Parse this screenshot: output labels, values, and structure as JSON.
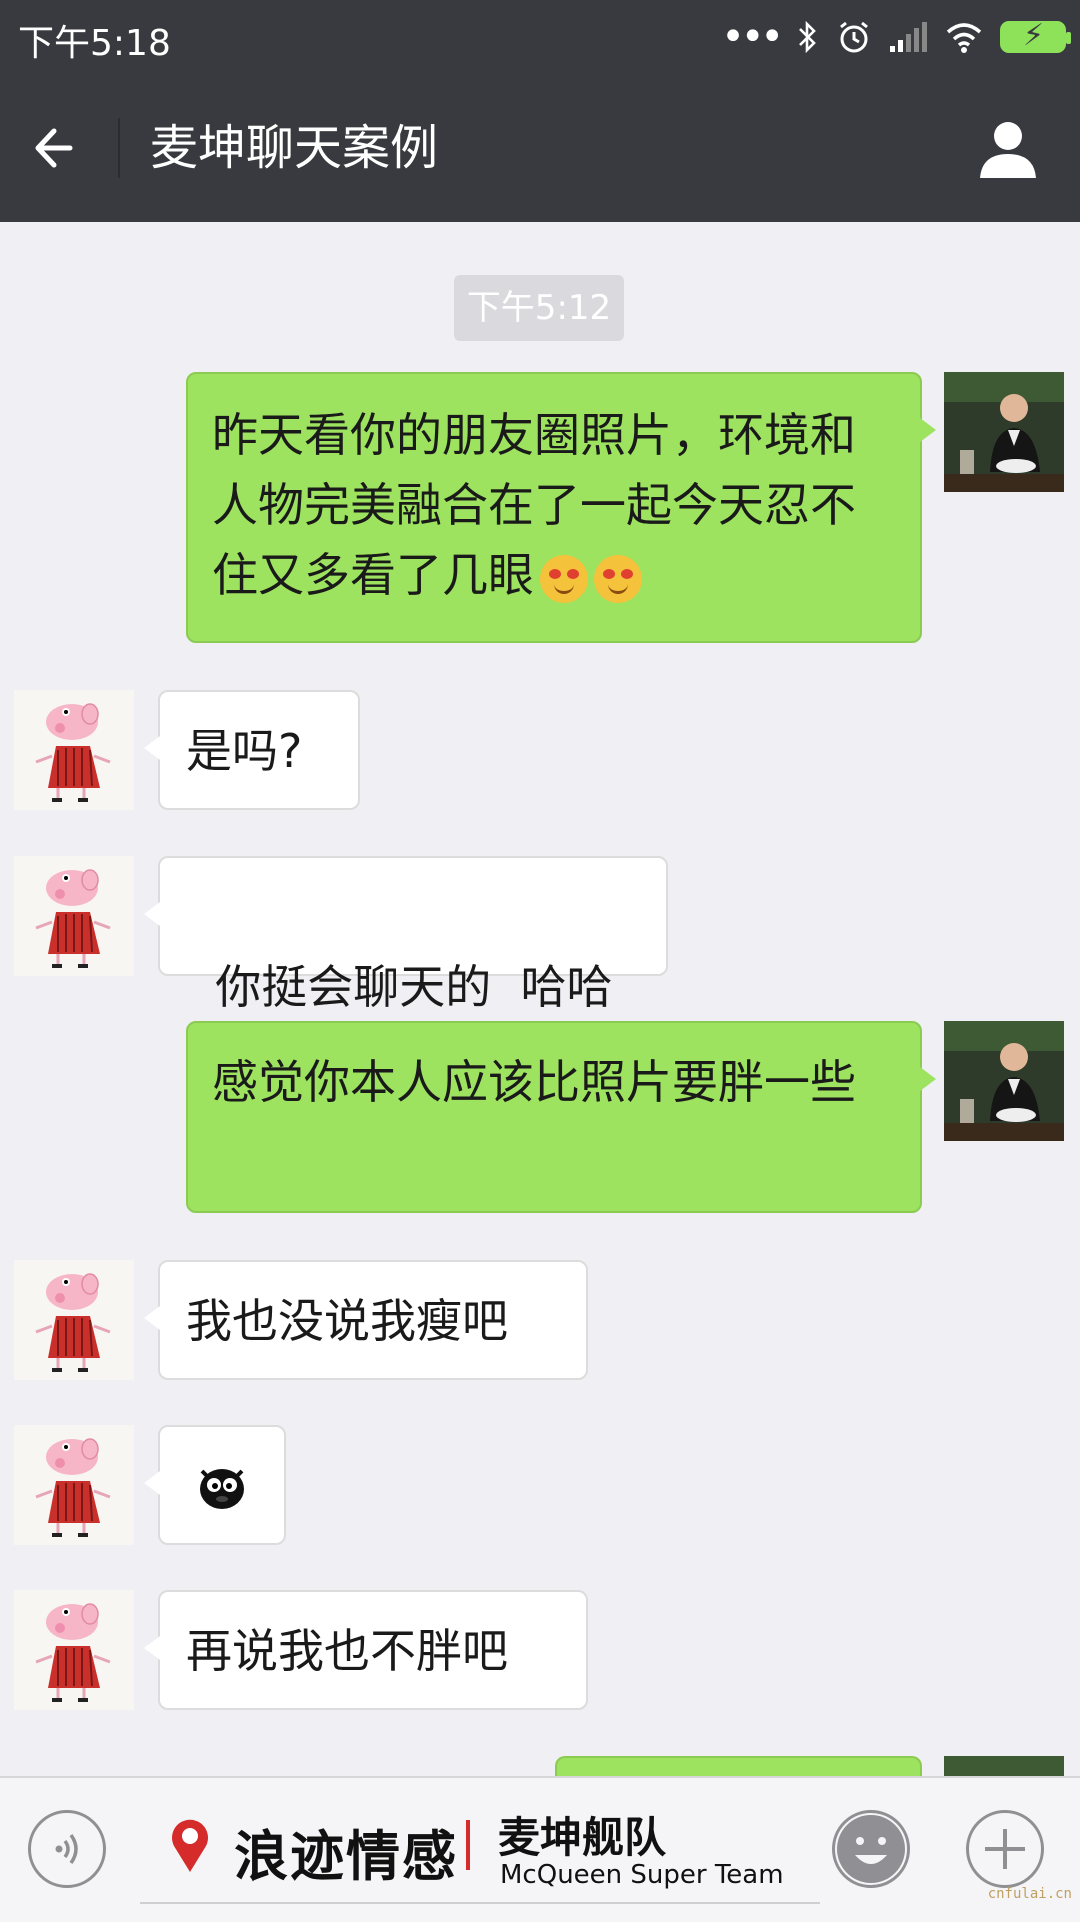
{
  "status_bar": {
    "time": "下午5:18",
    "battery_color": "#8ee25a"
  },
  "header": {
    "title": "麦坤聊天案例",
    "back_icon": "arrow-left-icon",
    "profile_icon": "person-icon"
  },
  "chat": {
    "timestamp": "下午5:12",
    "messages": [
      {
        "from": "me",
        "text": "昨天看你的朋友圈照片，环境和人物完美融合在了一起今天忍不住又多看了几眼",
        "emoji": [
          "heart-eyes-emoji",
          "heart-eyes-emoji"
        ]
      },
      {
        "from": "them",
        "text": "是吗?"
      },
      {
        "from": "them",
        "text": "你挺会聊天的  哈哈"
      },
      {
        "from": "me",
        "text": "感觉你本人应该比照片要胖一些"
      },
      {
        "from": "them",
        "text": "我也没说我瘦吧"
      },
      {
        "from": "them",
        "sticker": "black-creature-sticker"
      },
      {
        "from": "them",
        "text": "再说我也不胖吧"
      },
      {
        "from": "me",
        "text": ""
      }
    ]
  },
  "bottom_bar": {
    "voice_icon": "voice-icon",
    "brand_name": "浪迹情感",
    "team_name": "麦坤舰队",
    "team_name_en": "McQueen Super Team",
    "emoji_icon": "smiley-icon",
    "plus_icon": "plus-icon",
    "watermark": "cnfulai.cn"
  },
  "colors": {
    "header_bg": "#393a3f",
    "chat_bg": "#efeff4",
    "my_bubble": "#9de35f",
    "their_bubble": "#ffffff"
  }
}
